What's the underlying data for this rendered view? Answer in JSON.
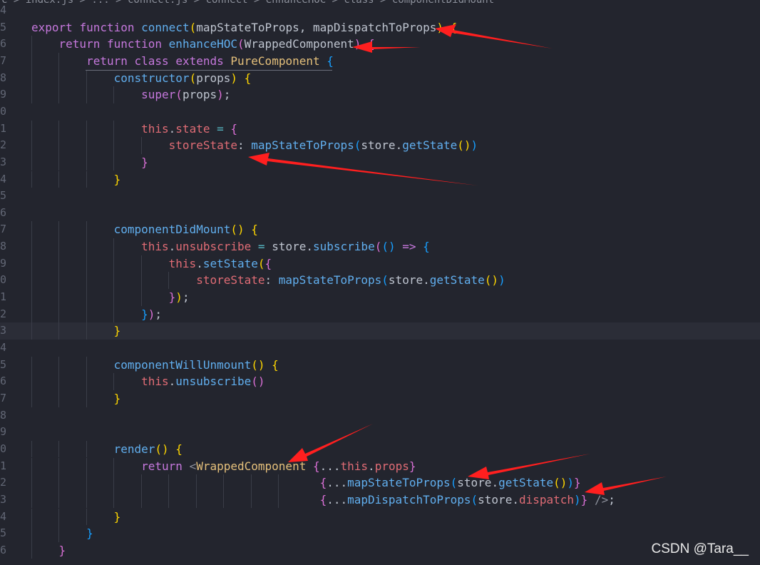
{
  "breadcrumb": "c > index.js > ... > connect.js > connect > enhanceHOC > class > componentDidMount",
  "watermark": "CSDN @Tara__",
  "lines": [
    {
      "num": "4",
      "html": ""
    },
    {
      "num": "5",
      "html": "<span class=\"kw\">export</span> <span class=\"kw\">function</span> <span class=\"fn\">connect</span><span class=\"br1\">(</span><span class=\"par\">mapStateToProps</span>, <span class=\"par\">mapDispatchToProps</span><span class=\"br1\">)</span> <span class=\"br1\">{</span>"
    },
    {
      "num": "6",
      "html": "    <span class=\"kw\">return</span> <span class=\"kw\">function</span> <span class=\"fn\">enhanceHOC</span><span class=\"br2\">(</span><span class=\"par\">WrappedComponent</span><span class=\"br2\">)</span> <span class=\"br2\">{</span>"
    },
    {
      "num": "7",
      "html": "        <span class=\"kw\">return</span> <span class=\"kw\">class</span> <span class=\"kw\">extends</span> <span class=\"cls\">PureComponent</span> <span class=\"br3\">{</span>"
    },
    {
      "num": "8",
      "html": "            <span class=\"fn\">constructor</span><span class=\"br1\">(</span><span class=\"par\">props</span><span class=\"br1\">)</span> <span class=\"br1\">{</span>"
    },
    {
      "num": "9",
      "html": "                <span class=\"kw\">super</span><span class=\"br2\">(</span><span class=\"par\">props</span><span class=\"br2\">)</span>;"
    },
    {
      "num": "0",
      "html": ""
    },
    {
      "num": "1",
      "html": "                <span class=\"this\">this</span>.<span class=\"prop\">state</span> <span class=\"op\">=</span> <span class=\"br2\">{</span>"
    },
    {
      "num": "2",
      "html": "                    <span class=\"prop\">storeState</span>: <span class=\"fn\">mapStateToProps</span><span class=\"br3\">(</span><span class=\"var\">store</span>.<span class=\"fn\">getState</span><span class=\"br1\">()</span><span class=\"br3\">)</span>"
    },
    {
      "num": "3",
      "html": "                <span class=\"br2\">}</span>"
    },
    {
      "num": "4",
      "html": "            <span class=\"br1\">}</span>"
    },
    {
      "num": "5",
      "html": ""
    },
    {
      "num": "6",
      "html": ""
    },
    {
      "num": "7",
      "html": "            <span class=\"fn\">componentDidMount</span><span class=\"br1\">()</span> <span class=\"br1\">{</span>"
    },
    {
      "num": "8",
      "html": "                <span class=\"this\">this</span>.<span class=\"prop\">unsubscribe</span> <span class=\"op\">=</span> <span class=\"var\">store</span>.<span class=\"fn\">subscribe</span><span class=\"br2\">(</span><span class=\"br3\">()</span> <span class=\"kw\">=&gt;</span> <span class=\"br3\">{</span>"
    },
    {
      "num": "9",
      "html": "                    <span class=\"this\">this</span>.<span class=\"fn\">setState</span><span class=\"br1\">(</span><span class=\"br2\">{</span>"
    },
    {
      "num": "0",
      "html": "                        <span class=\"prop\">storeState</span>: <span class=\"fn\">mapStateToProps</span><span class=\"br3\">(</span><span class=\"var\">store</span>.<span class=\"fn\">getState</span><span class=\"br1\">()</span><span class=\"br3\">)</span>"
    },
    {
      "num": "1",
      "html": "                    <span class=\"br2\">}</span><span class=\"br1\">)</span>;"
    },
    {
      "num": "2",
      "html": "                <span class=\"br3\">}</span><span class=\"br2\">)</span>;"
    },
    {
      "num": "3",
      "html": "            <span class=\"br1\">}</span>"
    },
    {
      "num": "4",
      "html": ""
    },
    {
      "num": "5",
      "html": "            <span class=\"fn\">componentWillUnmount</span><span class=\"br1\">()</span> <span class=\"br1\">{</span>"
    },
    {
      "num": "6",
      "html": "                <span class=\"this\">this</span>.<span class=\"fn\">unsubscribe</span><span class=\"br2\">()</span>"
    },
    {
      "num": "7",
      "html": "            <span class=\"br1\">}</span>"
    },
    {
      "num": "8",
      "html": ""
    },
    {
      "num": "9",
      "html": ""
    },
    {
      "num": "0",
      "html": "            <span class=\"fn\">render</span><span class=\"br1\">()</span> <span class=\"br1\">{</span>"
    },
    {
      "num": "1",
      "html": "                <span class=\"kw\">return</span> <span class=\"tagp\">&lt;</span><span class=\"jsx\">WrappedComponent</span> <span class=\"br2\">{</span>...<span class=\"this\">this</span>.<span class=\"prop\">props</span><span class=\"br2\">}</span>"
    },
    {
      "num": "2",
      "html": "                                          <span class=\"br2\">{</span>...<span class=\"fn\">mapStateToProps</span><span class=\"br3\">(</span><span class=\"var\">store</span>.<span class=\"fn\">getState</span><span class=\"br1\">()</span><span class=\"br3\">)</span><span class=\"br2\">}</span>"
    },
    {
      "num": "3",
      "html": "                                          <span class=\"br2\">{</span>...<span class=\"fn\">mapDispatchToProps</span><span class=\"br3\">(</span><span class=\"var\">store</span>.<span class=\"prop\">dispatch</span><span class=\"br3\">)</span><span class=\"br2\">}</span> <span class=\"tagp\">/&gt;</span>;"
    },
    {
      "num": "4",
      "html": "            <span class=\"br1\">}</span>"
    },
    {
      "num": "5",
      "html": "        <span class=\"br3\">}</span>"
    },
    {
      "num": "6",
      "html": "    <span class=\"br2\">}</span>"
    }
  ]
}
